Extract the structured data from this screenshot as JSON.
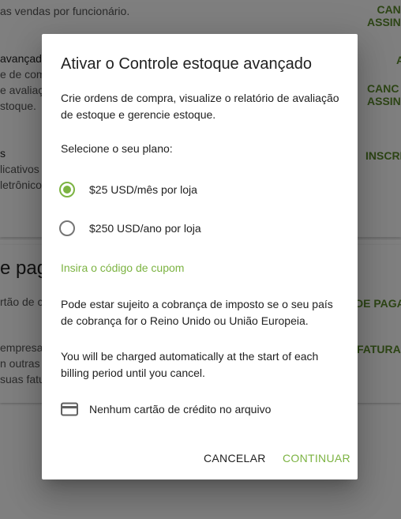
{
  "background": {
    "row1_text": "as vendas por funcionário.",
    "row1_action": "CANC\nASSINA",
    "row2_title": "avançado",
    "row2_lines": [
      "e de comp",
      "e avaliaç",
      "stoque."
    ],
    "row2_action_top": "A",
    "row2_action": "CANC\nASSINA",
    "row3_title": "s",
    "row3_lines": [
      "licativos",
      "letrônico"
    ],
    "row3_action": "INSCRE",
    "section_title": "e paga",
    "row4_text": "rtão de c",
    "row4_action": "DE PAGAM",
    "row5_lines": [
      "empresa,",
      "n outras i",
      "suas fatu"
    ],
    "row5_action": "FATURAM"
  },
  "dialog": {
    "title": "Ativar o Controle estoque avançado",
    "description": "Crie ordens de compra, visualize o relatório de avaliação de estoque e gerencie estoque.",
    "plan_prompt": "Selecione o seu plano:",
    "plans": [
      {
        "label": "$25 USD/mês por loja",
        "selected": true
      },
      {
        "label": "$250 USD/ano por loja",
        "selected": false
      }
    ],
    "coupon_link": "Insira o código de cupom",
    "tax_notice": "Pode estar sujeito a cobrança de imposto se o seu país de cobrança for o Reino Unido ou União Europeia.",
    "billing_notice": "You will be charged automatically at the start of each billing period until you cancel.",
    "card_icon": "credit-card-icon",
    "card_status": "Nenhum cartão de crédito no arquivo",
    "cancel_label": "CANCELAR",
    "continue_label": "CONTINUAR"
  },
  "colors": {
    "accent": "#7cb342",
    "scrim": "rgba(0,0,0,0.5)"
  }
}
